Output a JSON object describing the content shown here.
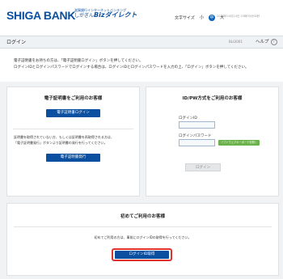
{
  "header": {
    "bank_name": "SHIGA BANK",
    "service_line1": "滋賀銀行インターネットバンキング",
    "service_prefix": "しがぎん",
    "service_name": "Bizダイレクト",
    "font_size_label": "文字サイズ",
    "font_sizes": [
      "小",
      "中",
      "大"
    ],
    "datetime": "2016年04月14日 10時00分00秒"
  },
  "titlebar": {
    "title": "ログイン",
    "screen_code": "BLGI001",
    "help_label": "ヘルプ",
    "help_icon": "?"
  },
  "intro": {
    "line1": "電子証明書をお持ちの方は、「電子証明書ログイン」ボタンを押してください。",
    "line2": "ログインIDとログインパスワードでログインする場合は、ログインIDとログインパスワードを入力の上、「ログイン」ボタンを押してください。"
  },
  "cert_panel": {
    "title": "電子証明書をご利用のお客様",
    "login_button": "電子証明書ログイン",
    "note_line1": "証明書を取得されていない方、もしくは証明書を再取得される方は、",
    "note_line2": "「電子証明書発行」ボタンより証明書の発行を行ってください。",
    "issue_button": "電子証明書発行"
  },
  "idpw_panel": {
    "title": "ID/PW方式をご利用のお客様",
    "login_id_label": "ログインID",
    "login_id_value": "",
    "password_label": "ログインパスワード",
    "password_value": "",
    "soft_keyboard_button": "ソフトウェアキーボードを開く",
    "login_button": "ログイン"
  },
  "first_panel": {
    "title": "初めてご利用のお客様",
    "text": "初めてご利用の方は、事前にログインIDの取得を行ってください。",
    "button": "ログインID取得"
  },
  "colors": {
    "brand_blue": "#0a4fa0",
    "highlight_red": "#e0332e",
    "keyboard_green": "#6bb24a"
  }
}
